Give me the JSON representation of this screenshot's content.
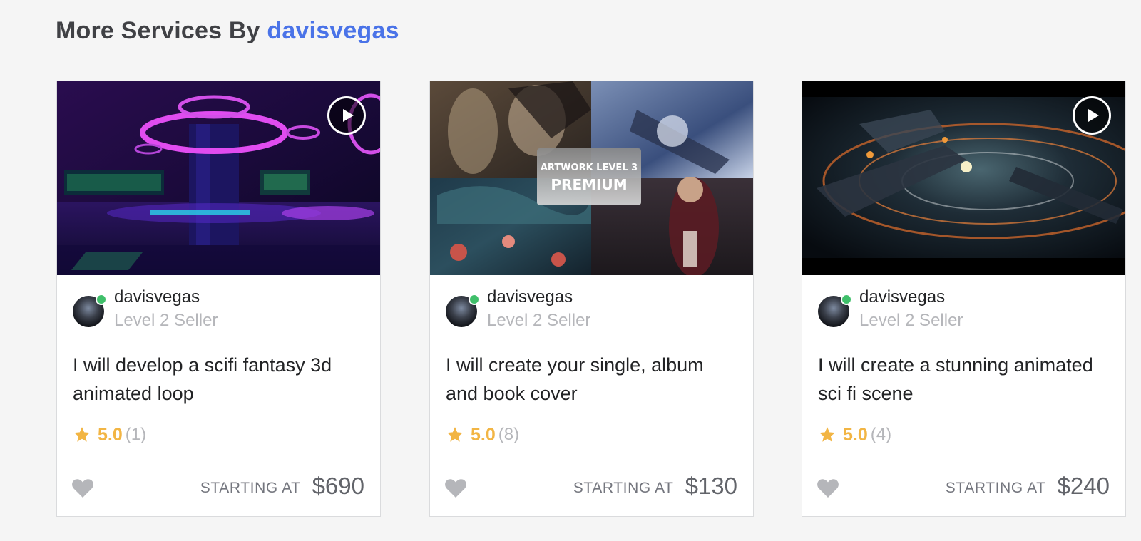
{
  "section": {
    "title_prefix": "More Services By",
    "title_seller": "davisvegas"
  },
  "gigs": [
    {
      "seller_name": "davisvegas",
      "seller_level": "Level 2 Seller",
      "title": "I will develop a scifi fantasy 3d animated loop",
      "rating": "5.0",
      "reviews": "(1)",
      "starting_label": "STARTING AT",
      "price": "$690",
      "has_video": true
    },
    {
      "seller_name": "davisvegas",
      "seller_level": "Level 2 Seller",
      "title": "I will create your single, album and book cover",
      "rating": "5.0",
      "reviews": "(8)",
      "starting_label": "STARTING AT",
      "price": "$130",
      "has_video": false,
      "thumb_overlay_line1": "ARTWORK LEVEL 3",
      "thumb_overlay_line2": "PREMIUM"
    },
    {
      "seller_name": "davisvegas",
      "seller_level": "Level 2 Seller",
      "title": "I will create a stunning animated sci fi scene",
      "rating": "5.0",
      "reviews": "(4)",
      "starting_label": "STARTING AT",
      "price": "$240",
      "has_video": true
    }
  ],
  "colors": {
    "accent_link": "#4a73e8",
    "rating_star": "#f2b544",
    "online": "#3fbf6a"
  },
  "icons": {
    "play": "play-icon",
    "star": "star-icon",
    "heart": "heart-icon"
  }
}
